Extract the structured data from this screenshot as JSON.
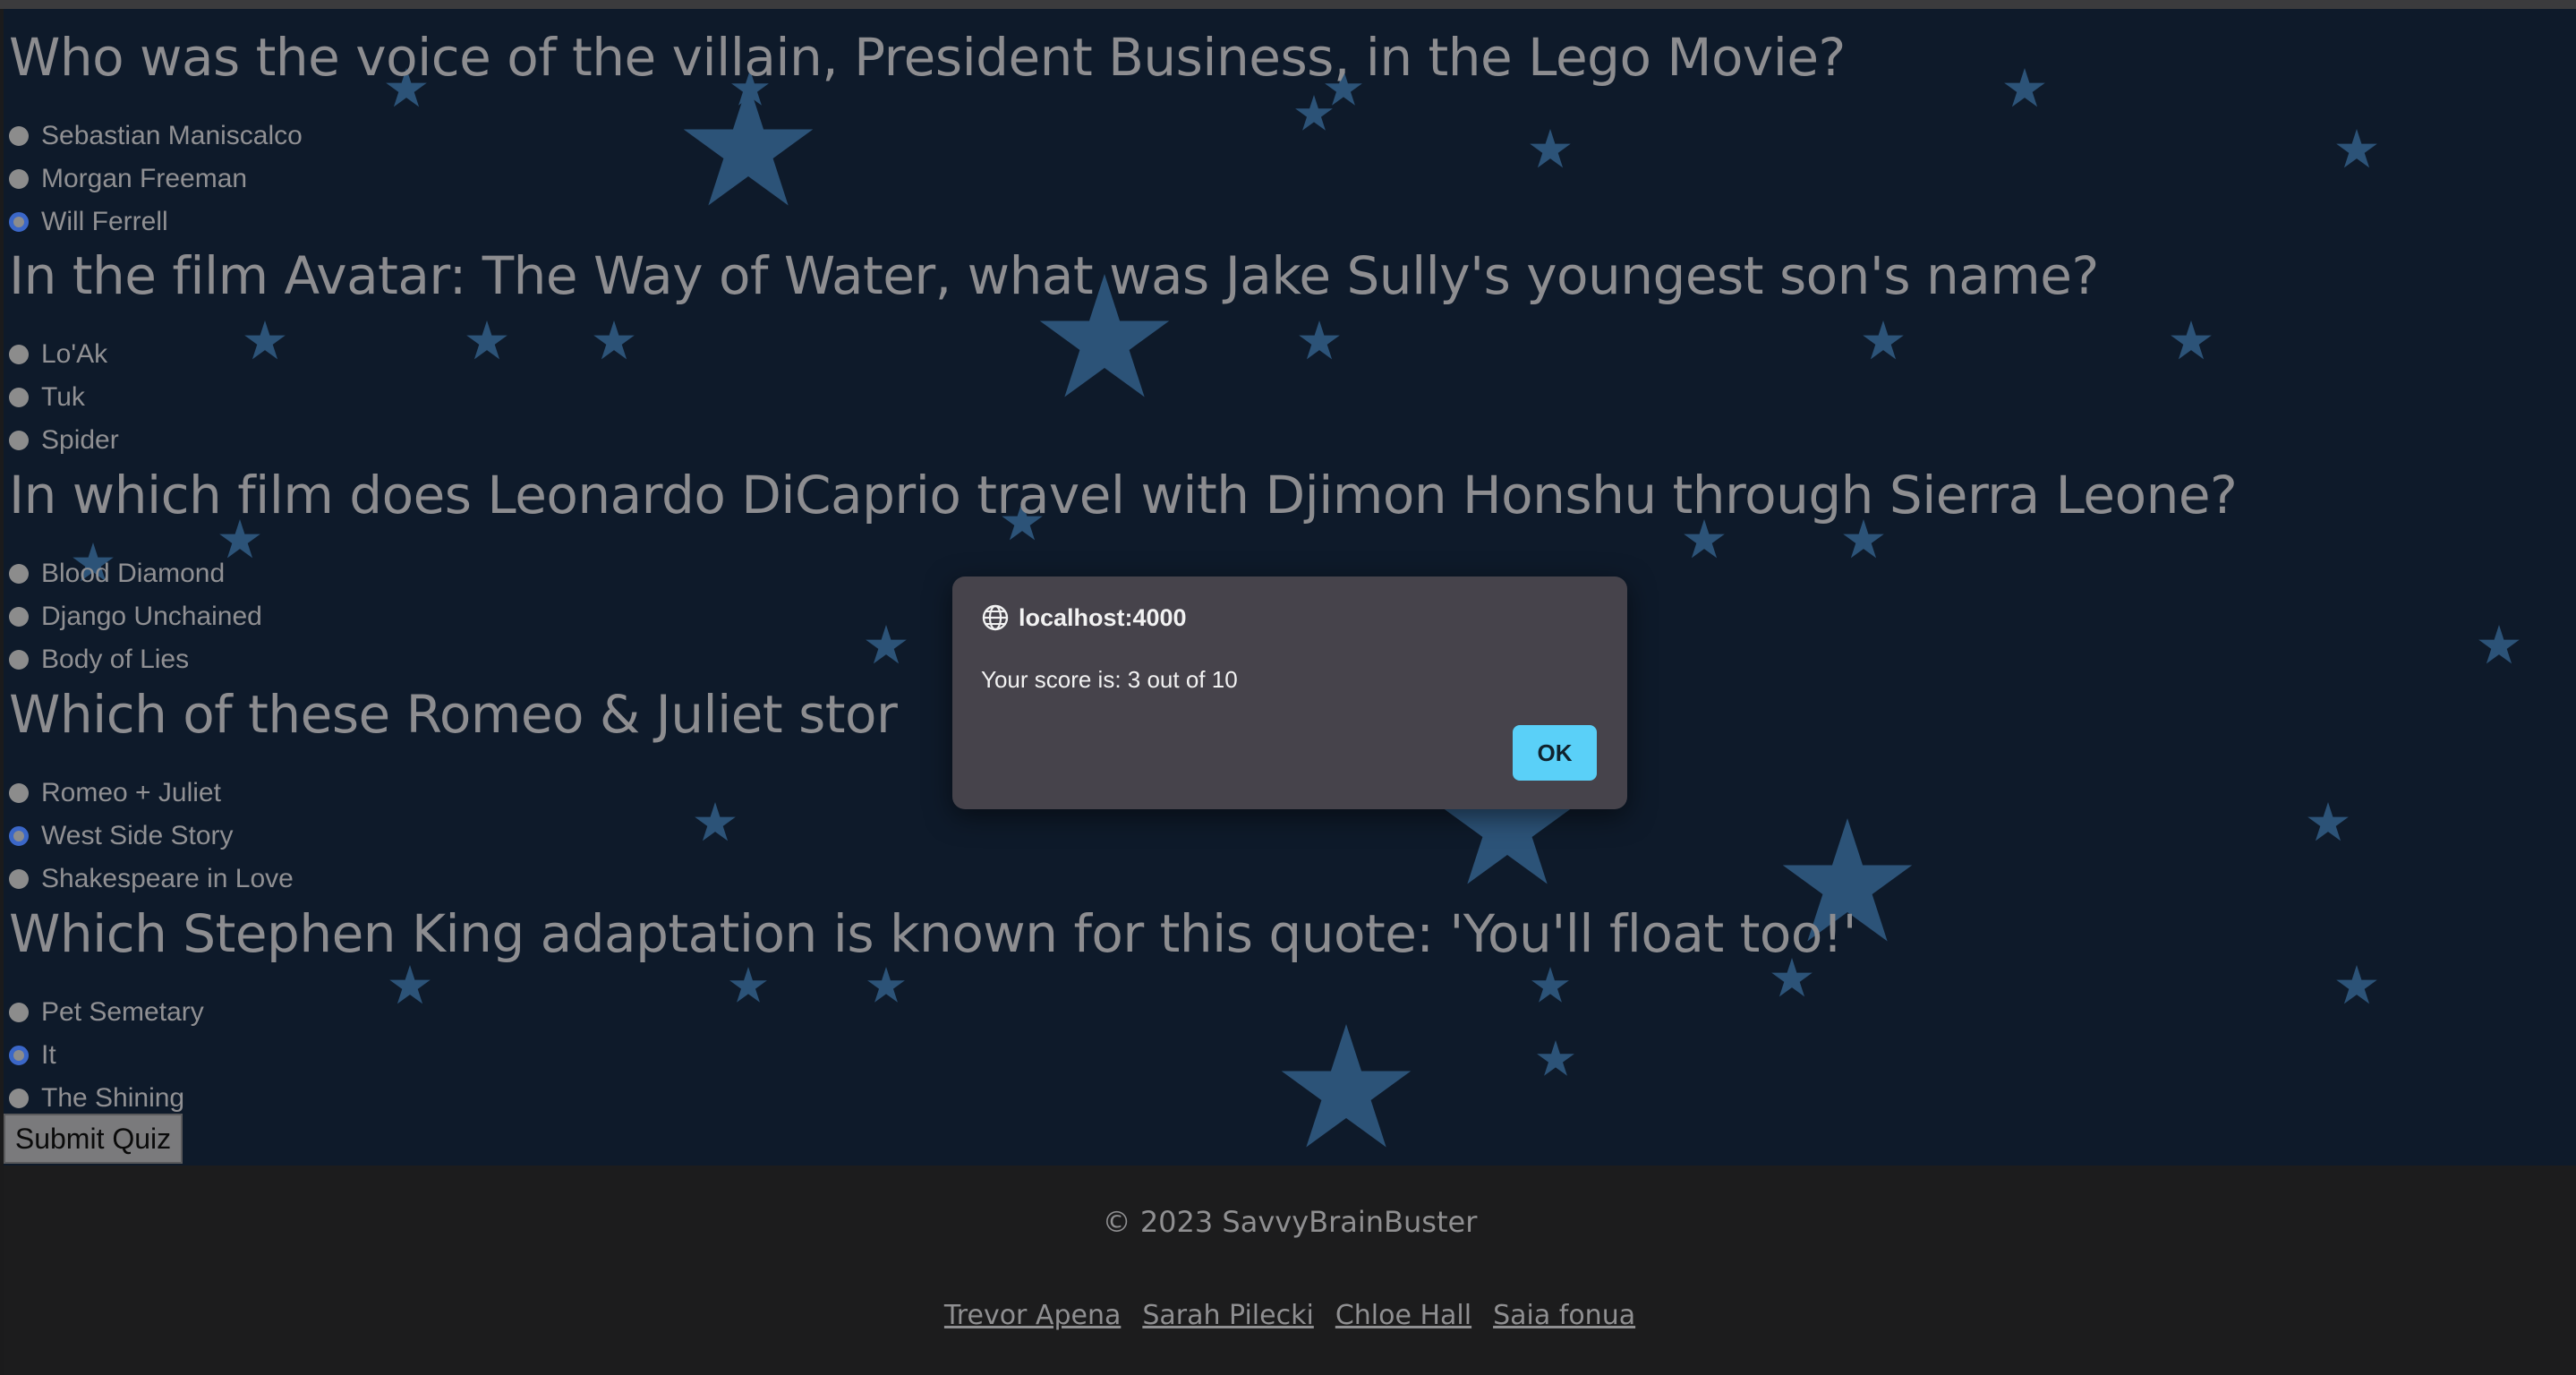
{
  "quiz": {
    "questions": [
      {
        "text": "Who was the voice of the villain, President Business, in the Lego Movie?",
        "options": [
          {
            "label": "Sebastian Maniscalco",
            "checked": false
          },
          {
            "label": "Morgan Freeman",
            "checked": false
          },
          {
            "label": "Will Ferrell",
            "checked": true
          }
        ]
      },
      {
        "text": "In the film Avatar: The Way of Water, what was Jake Sully's youngest son's name?",
        "options": [
          {
            "label": "Lo'Ak",
            "checked": false
          },
          {
            "label": "Tuk",
            "checked": false
          },
          {
            "label": "Spider",
            "checked": false
          }
        ]
      },
      {
        "text": "In which film does Leonardo DiCaprio travel with Djimon Honshu through Sierra Leone?",
        "options": [
          {
            "label": "Blood Diamond",
            "checked": false
          },
          {
            "label": "Django Unchained",
            "checked": false
          },
          {
            "label": "Body of Lies",
            "checked": false
          }
        ]
      },
      {
        "text": "Which of these Romeo & Juliet stor",
        "options": [
          {
            "label": "Romeo + Juliet",
            "checked": false
          },
          {
            "label": "West Side Story",
            "checked": true
          },
          {
            "label": "Shakespeare in Love",
            "checked": false
          }
        ]
      },
      {
        "text": "Which Stephen King adaptation is known for this quote: 'You'll float too!'",
        "options": [
          {
            "label": "Pet Semetary",
            "checked": false
          },
          {
            "label": "It",
            "checked": true
          },
          {
            "label": "The Shining",
            "checked": false
          }
        ]
      }
    ],
    "submit_label": "Submit Quiz"
  },
  "footer": {
    "copyright": "© 2023 SavvyBrainBuster",
    "authors": [
      "Trevor Apena",
      "Sarah Pilecki",
      "Chloe Hall",
      "Saia fonua"
    ]
  },
  "dialog": {
    "title": "localhost:4000",
    "message": "Your score is: 3 out of 10",
    "ok_label": "OK"
  },
  "colors": {
    "background": "#0e1a2a",
    "star": "#2c5378",
    "ok_button": "#5ad0f8",
    "radio_checked": "#3b67c8"
  }
}
